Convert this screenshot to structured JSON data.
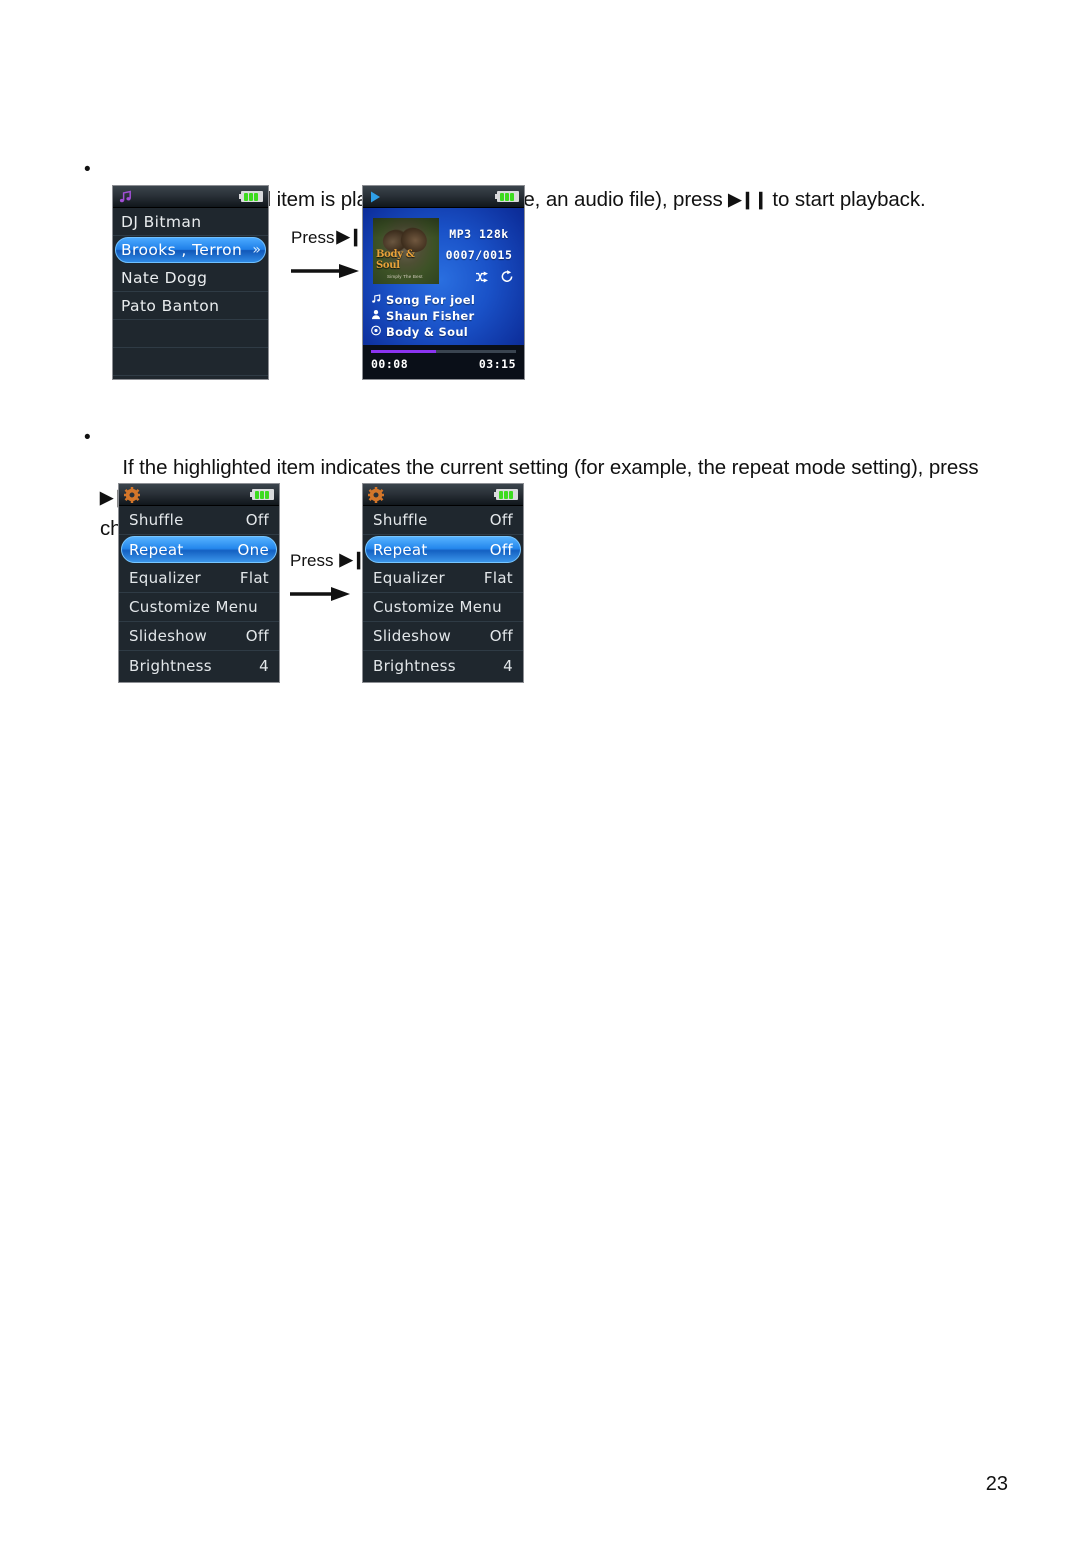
{
  "page": {
    "number": "23"
  },
  "bullets": [
    {
      "marker": "•",
      "text_before": "If the highlighted item is playable (for example, an audio file), press ",
      "glyph": "▶❙❙",
      "text_after": " to start playback."
    },
    {
      "marker": "•",
      "text_before": "If the highlighted item indicates the current setting (for example, the repeat mode setting), press ",
      "glyph": "▶❙❙",
      "text_after": " to\nchange the setting."
    }
  ],
  "press_labels": {
    "first": "Press",
    "second": "Press",
    "glyph": "▶❙❙"
  },
  "screens": {
    "artist_list": {
      "title_icon": "music-note-icon",
      "battery_icon": "battery-full-icon",
      "rows": [
        {
          "label": "DJ Bitman",
          "selected": false,
          "chevron": ""
        },
        {
          "label": "Brooks , Terron",
          "selected": true,
          "chevron": "»"
        },
        {
          "label": "Nate Dogg",
          "selected": false,
          "chevron": ""
        },
        {
          "label": "Pato Banton",
          "selected": false,
          "chevron": ""
        },
        {
          "label": "",
          "selected": false,
          "chevron": ""
        },
        {
          "label": "",
          "selected": false,
          "chevron": ""
        }
      ]
    },
    "now_playing": {
      "title_icon": "play-icon",
      "battery_icon": "battery-full-icon",
      "album_art": {
        "title": "Body & Soul",
        "subtitle": "Simply The Best"
      },
      "format": "MP3 128k",
      "track_index": "0007/0015",
      "mode_icons": [
        "shuffle-icon",
        "repeat-icon"
      ],
      "song_title": "Song For joel",
      "artist": "Shaun Fisher",
      "album": "Body & Soul",
      "elapsed": "00:08",
      "duration": "03:15",
      "progress_percent": 45
    },
    "settings_before": {
      "title_icon": "gear-icon",
      "battery_icon": "battery-full-icon",
      "rows": [
        {
          "label": "Shuffle",
          "value": "Off",
          "selected": false
        },
        {
          "label": "Repeat",
          "value": "One",
          "selected": true
        },
        {
          "label": "Equalizer",
          "value": "Flat",
          "selected": false
        },
        {
          "label": "Customize Menu",
          "value": "",
          "selected": false
        },
        {
          "label": "Slideshow",
          "value": "Off",
          "selected": false
        },
        {
          "label": "Brightness",
          "value": "4",
          "selected": false
        }
      ]
    },
    "settings_after": {
      "title_icon": "gear-icon",
      "battery_icon": "battery-full-icon",
      "rows": [
        {
          "label": "Shuffle",
          "value": "Off",
          "selected": false
        },
        {
          "label": "Repeat",
          "value": "Off",
          "selected": true
        },
        {
          "label": "Equalizer",
          "value": "Flat",
          "selected": false
        },
        {
          "label": "Customize Menu",
          "value": "",
          "selected": false
        },
        {
          "label": "Slideshow",
          "value": "Off",
          "selected": false
        },
        {
          "label": "Brightness",
          "value": "4",
          "selected": false
        }
      ]
    }
  },
  "colors": {
    "highlight_blue": "#2487ec",
    "battery_green": "#3cdb1e",
    "progress_purple": "#8b34f0",
    "screen_bg": "#1f272e",
    "gear_orange": "#d4762a",
    "note_purple": "#a24fd6"
  }
}
